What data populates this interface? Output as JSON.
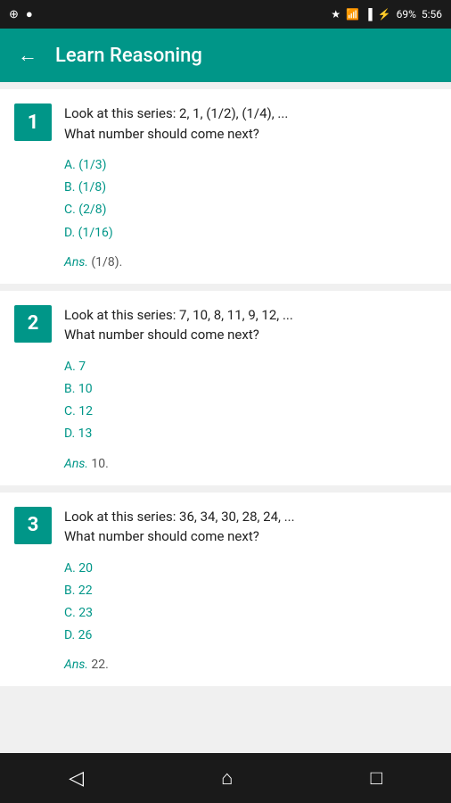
{
  "statusBar": {
    "leftIcons": [
      "⊕",
      "●"
    ],
    "rightItems": [
      "★",
      "WiFi",
      "Signal",
      "⚡",
      "69%",
      "5:56"
    ]
  },
  "appBar": {
    "backLabel": "←",
    "title": "Learn Reasoning"
  },
  "questions": [
    {
      "number": "1",
      "questionText": "Look at this series: 2, 1, (1/2), (1/4), ...\nWhat number should come next?",
      "options": [
        "A. (1/3)",
        "B. (1/8)",
        "C. (2/8)",
        "D. (1/16)"
      ],
      "answerLabel": "Ans.",
      "answerValue": "(1/8)."
    },
    {
      "number": "2",
      "questionText": "Look at this series: 7, 10, 8, 11, 9, 12, ...\nWhat number should come next?",
      "options": [
        "A. 7",
        "B. 10",
        "C. 12",
        "D. 13"
      ],
      "answerLabel": "Ans.",
      "answerValue": "10."
    },
    {
      "number": "3",
      "questionText": "Look at this series: 36, 34, 30, 28, 24, ...\nWhat number should come next?",
      "options": [
        "A. 20",
        "B. 22",
        "C. 23",
        "D. 26"
      ],
      "answerLabel": "Ans.",
      "answerValue": "22."
    }
  ],
  "bottomNav": {
    "backSymbol": "◁",
    "homeSymbol": "⌂",
    "squareSymbol": "□"
  }
}
